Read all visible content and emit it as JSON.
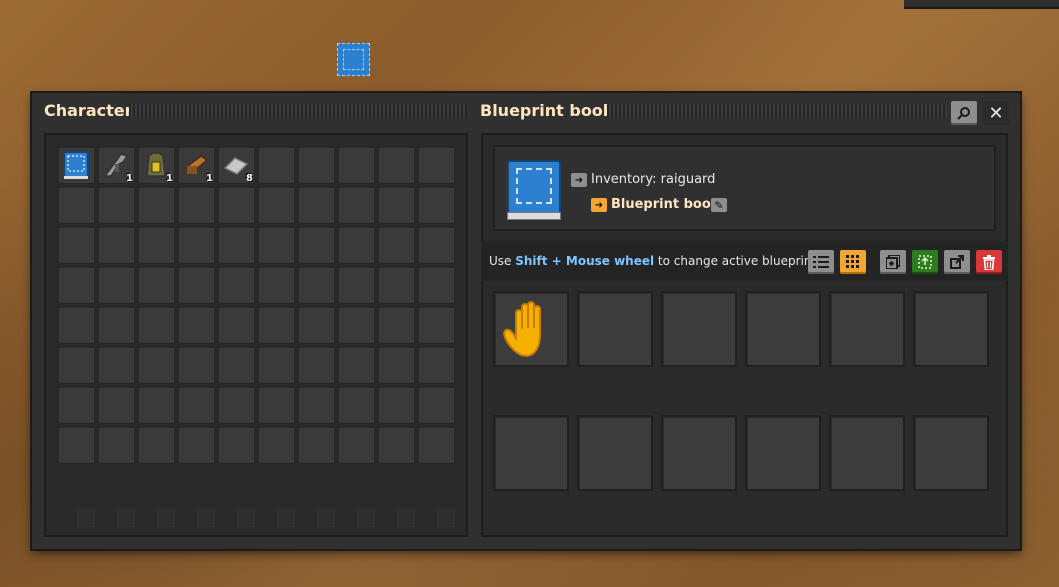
{
  "character_panel": {
    "title": "Character",
    "inventory": {
      "items": [
        {
          "name": "blueprint-book-icon",
          "count": ""
        },
        {
          "name": "submachine-gun-icon",
          "count": "1"
        },
        {
          "name": "armor-icon",
          "count": "1"
        },
        {
          "name": "pistol-icon",
          "count": "1"
        },
        {
          "name": "iron-plate-icon",
          "count": "8"
        }
      ]
    }
  },
  "blueprint_book": {
    "title": "Blueprint book",
    "inventory_label": "Inventory: raiguard",
    "book_label": "Blueprint book",
    "hint": {
      "prefix": "Use ",
      "highlight": "Shift + Mouse wheel",
      "suffix": " to change active blueprint."
    }
  },
  "colors": {
    "accent": "#f4a630",
    "title": "#ffe6c0",
    "highlight": "#7fc6ff",
    "danger": "#d93838",
    "confirm": "#2d7a1f"
  }
}
